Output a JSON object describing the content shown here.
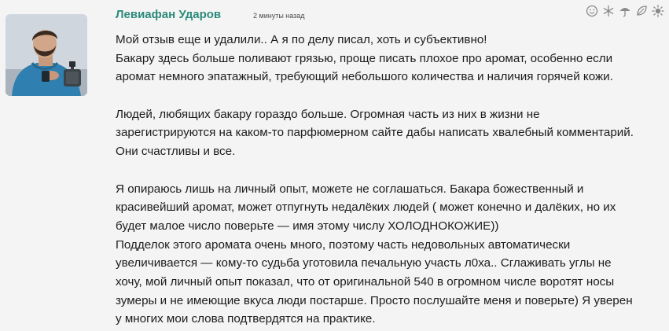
{
  "comment": {
    "author": "Левиафан Ударов",
    "timestamp": "2 минуты назад",
    "lines": [
      "Мой отзыв еще и удалили.. А я по делу писал, хоть и субъективно!",
      "Бакару здесь больше поливают грязью, проще писать плохое про аромат, особенно если",
      "аромат немного эпатажный, требующий небольшого количества и наличия горячей кожи.",
      "",
      "Людей, любящих бакару гораздо больше. Огромная часть из них в жизни не",
      "зарегистрируются на каком-то парфюмерном сайте дабы написать хвалебный комментарий.",
      "Они счастливы и все.",
      "",
      "Я опираюсь лишь на личный опыт, можете не соглашаться. Бакара божественный и",
      "красивейший аромат, может отпугнуть недалёких людей ( может конечно и далёких, но их",
      "будет малое число поверьте — имя этому числу ХОЛОДНОКОЖИЕ))",
      "Подделок этого аромата очень много, поэтому часть недовольных автоматически",
      "увеличивается — кому-то судьба уготовила печальную участь л0ха.. Сглаживать углы не",
      "хочу, мой личный опыт показал, что от оригинальной 540 в огромном числе воротят носы",
      "зумеры и не имеющие вкуса люди постарше. Просто послушайте меня и поверьте) Я уверен",
      "у многих мои слова подтвердятся на практике."
    ]
  },
  "reactions": [
    {
      "icon": "smiley-icon"
    },
    {
      "icon": "snowflake-icon"
    },
    {
      "icon": "umbrella-icon"
    },
    {
      "icon": "leaf-icon"
    },
    {
      "icon": "sun-icon"
    }
  ],
  "colors": {
    "author": "#2b8a7a",
    "icon": "#8a8a8a",
    "background": "#f4f4f4",
    "text": "#1c1c1c"
  }
}
